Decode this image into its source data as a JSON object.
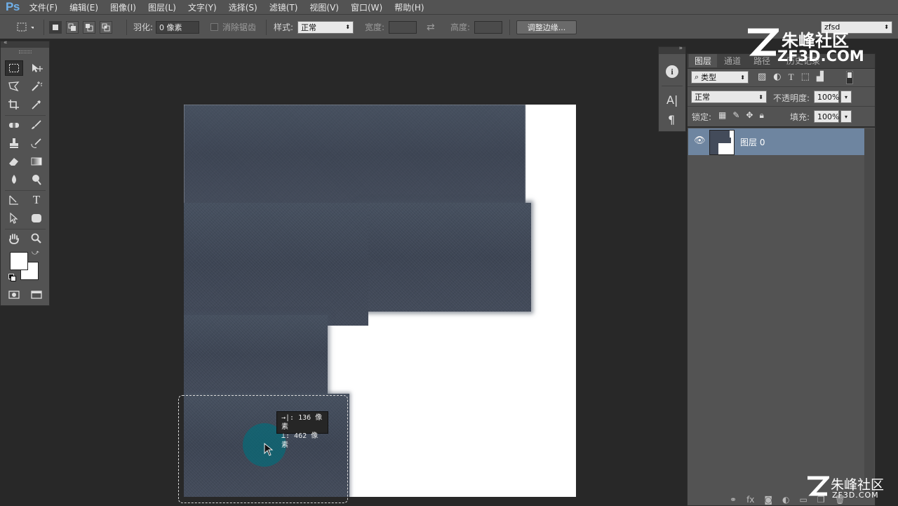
{
  "app": {
    "logo": "Ps"
  },
  "menu": [
    "文件(F)",
    "编辑(E)",
    "图像(I)",
    "图层(L)",
    "文字(Y)",
    "选择(S)",
    "滤镜(T)",
    "视图(V)",
    "窗口(W)",
    "帮助(H)"
  ],
  "options": {
    "feather_label": "羽化:",
    "feather_value": "0 像素",
    "antialias_label": "消除锯齿",
    "style_label": "样式:",
    "style_value": "正常",
    "width_label": "宽度:",
    "height_label": "高度:",
    "refine_edge_button": "调整边缘...",
    "workspace_value": "zfsd"
  },
  "tooltip": {
    "line1": "→|: 136 像素",
    "line2": "⊥: 462 像素"
  },
  "layers_panel": {
    "tabs": [
      "图层",
      "通道",
      "路径",
      "历史记录"
    ],
    "filter_kind": "类型",
    "blend_mode": "正常",
    "opacity_label": "不透明度:",
    "opacity_value": "100%",
    "lock_label": "锁定:",
    "fill_label": "填充:",
    "fill_value": "100%",
    "layers": [
      {
        "name": "图层 0",
        "visible": true,
        "selected": true
      }
    ]
  },
  "watermark": {
    "brand": "朱峰社区",
    "url": "ZF3D.COM"
  },
  "colors": {
    "foreground": "#ffffff",
    "background": "#ffffff",
    "selected_layer": "#6e85a0"
  }
}
